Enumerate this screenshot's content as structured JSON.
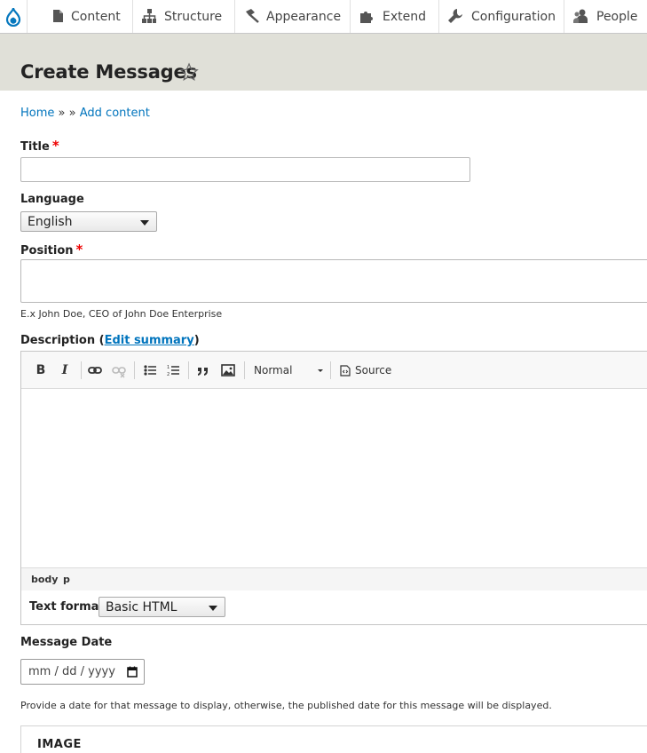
{
  "toolbar": {
    "items": [
      {
        "label": "Content",
        "icon": "page-icon"
      },
      {
        "label": "Structure",
        "icon": "hierarchy-icon"
      },
      {
        "label": "Appearance",
        "icon": "paint-brush-icon"
      },
      {
        "label": "Extend",
        "icon": "puzzle-icon"
      },
      {
        "label": "Configuration",
        "icon": "wrench-icon"
      },
      {
        "label": "People",
        "icon": "people-icon"
      }
    ]
  },
  "page": {
    "title": "Create Messages"
  },
  "breadcrumb": {
    "home": "Home",
    "sep1": "»",
    "sep2": "»",
    "add_content": "Add content"
  },
  "form": {
    "title": {
      "label": "Title",
      "required": "*",
      "value": ""
    },
    "language": {
      "label": "Language",
      "value": "English"
    },
    "position": {
      "label": "Position",
      "required": "*",
      "value": "",
      "help": "E.x John Doe, CEO of John Doe Enterprise"
    },
    "description": {
      "label": "Description (",
      "edit_summary": "Edit summary",
      "label_end": ")",
      "toolbar": {
        "bold": "B",
        "italic": "I",
        "paragraph_format": "Normal",
        "source": "Source"
      },
      "path": [
        "body",
        "p"
      ]
    },
    "text_format": {
      "label": "Text format",
      "value": "Basic HTML"
    },
    "message_date": {
      "label": "Message Date",
      "placeholder": "mm / dd / yyyy",
      "help": "Provide a date for that message to display, otherwise, the published date for this message will be displayed."
    },
    "image": {
      "title": "IMAGE"
    }
  },
  "colors": {
    "link": "#0074bd",
    "required": "#e00000",
    "header_bg": "#e0e0d8",
    "drupal_blue": "#0678be"
  }
}
